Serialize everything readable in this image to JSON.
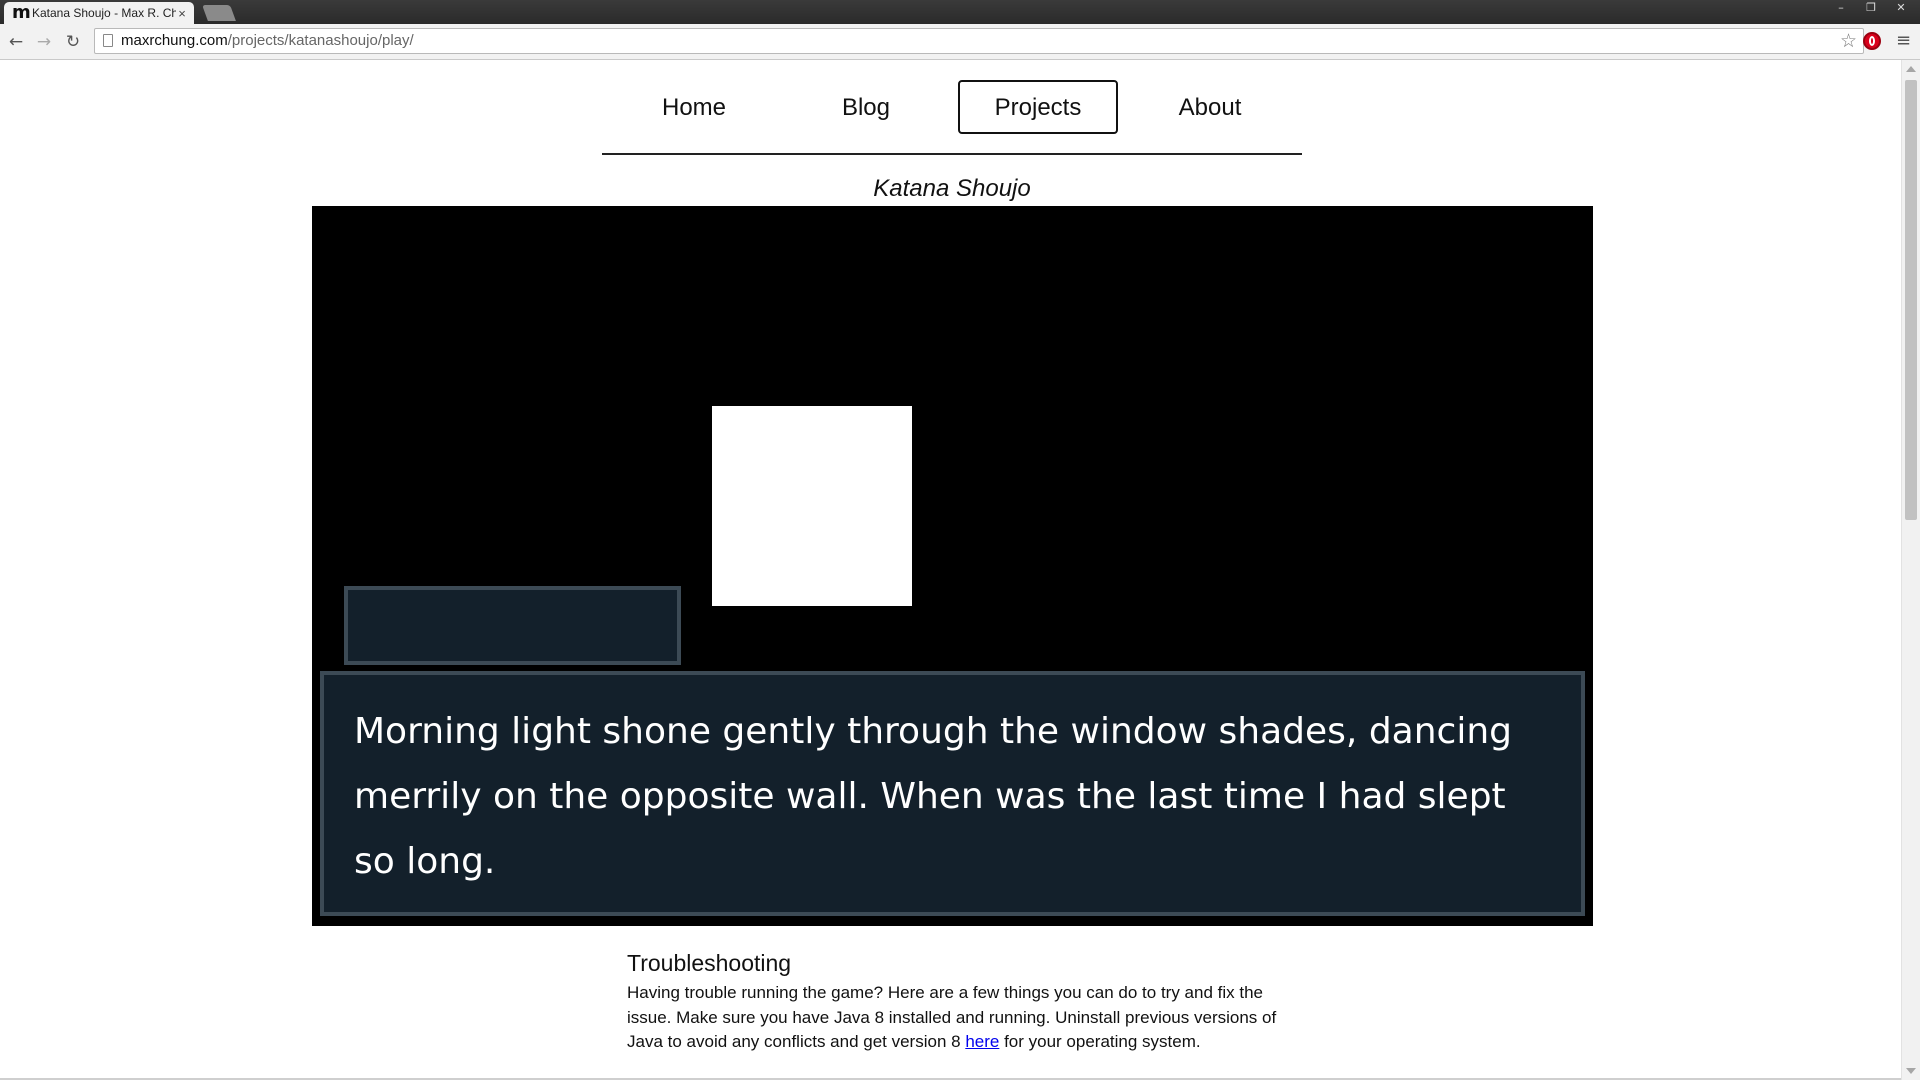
{
  "browser": {
    "tab_title": "Katana Shoujo - Max R. Ch",
    "tab_favicon": "m",
    "tab_close": "×",
    "url_host": "maxrchung.com",
    "url_path": "/projects/katanashoujo/play/",
    "window_controls": [
      "–",
      "❐",
      "✕"
    ]
  },
  "nav": {
    "items": [
      {
        "label": "Home"
      },
      {
        "label": "Blog"
      },
      {
        "label": "Projects",
        "active": true
      },
      {
        "label": "About"
      }
    ]
  },
  "game": {
    "title": "Katana Shoujo",
    "name_box_text": "",
    "dialogue": "Morning light shone gently through the window shades, dancing merrily on the opposite wall. When was the last time I had slept so long."
  },
  "troubleshooting": {
    "heading": "Troubleshooting",
    "text_before_link": "Having trouble running the game? Here are a few things you can do to try and fix the issue. Make sure you have Java 8 installed and running. Uninstall previous versions of Java to avoid any conflicts and get version 8 ",
    "link_text": "here",
    "text_after_link": " for your operating system."
  },
  "colors": {
    "game_background": "#000000",
    "dialogue_fill": "#13202b",
    "dialogue_border": "#3c4a55",
    "link": "#0000ee"
  },
  "icons": {
    "back": "back-arrow-icon",
    "forward": "forward-arrow-icon",
    "reload": "reload-icon",
    "bookmark": "star-icon",
    "extension": "opera-icon",
    "menu": "hamburger-menu-icon"
  }
}
